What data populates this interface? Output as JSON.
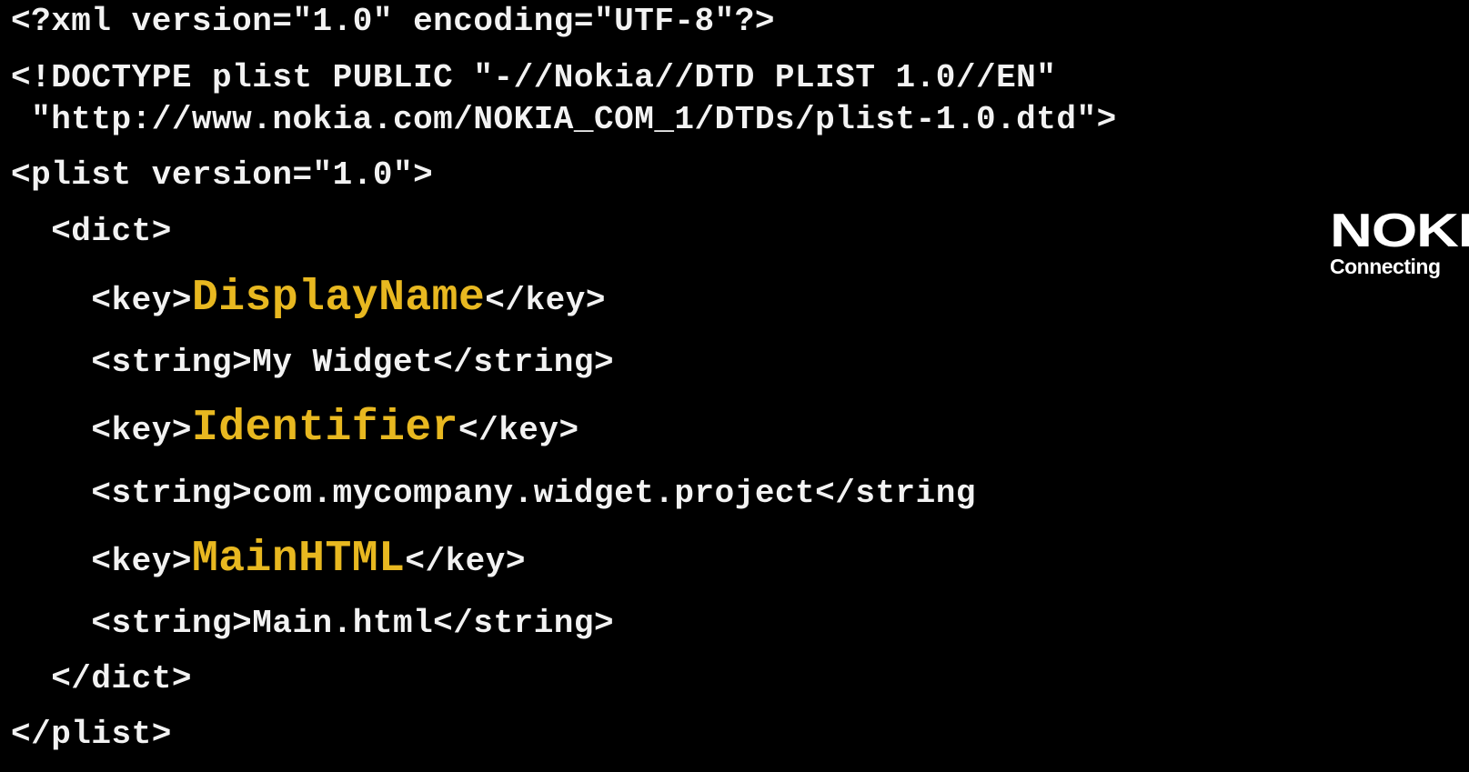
{
  "code": {
    "xml_decl": "<?xml version=\"1.0\" encoding=\"UTF-8\"?>",
    "doctype_1": "<!DOCTYPE plist PUBLIC \"-//Nokia//DTD PLIST 1.0//EN\"",
    "doctype_2": " \"http://www.nokia.com/NOKIA_COM_1/DTDs/plist-1.0.dtd\">",
    "plist_open": "<plist version=\"1.0\">",
    "dict_open": "  <dict>",
    "entries": [
      {
        "open": "    <key>",
        "key": "DisplayName",
        "close": "</key>"
      },
      {
        "value": "    <string>My Widget</string>"
      },
      {
        "open": "    <key>",
        "key": "Identifier",
        "close": "</key>"
      },
      {
        "value": "    <string>com.mycompany.widget.project</string"
      },
      {
        "open": "    <key>",
        "key": "MainHTML",
        "close": "</key>"
      },
      {
        "value": "    <string>Main.html</string>"
      }
    ],
    "dict_close": "  </dict>",
    "plist_close": "</plist>"
  },
  "logo": {
    "word": "NOKIA",
    "tagline": "Connecting People"
  },
  "colors": {
    "background": "#000000",
    "text": "#f2f2f2",
    "key_highlight": "#e8b820"
  }
}
